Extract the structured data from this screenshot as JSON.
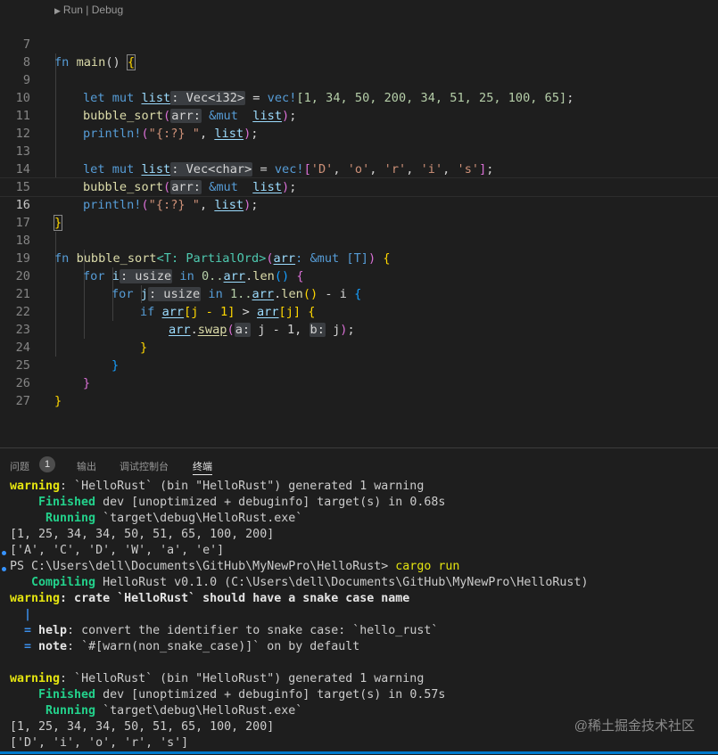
{
  "editor": {
    "codelens": {
      "run": "Run",
      "sep": "|",
      "debug": "Debug"
    },
    "lines": [
      {
        "n": "7"
      },
      {
        "n": "8"
      },
      {
        "n": "9"
      },
      {
        "n": "10"
      },
      {
        "n": "11"
      },
      {
        "n": "12"
      },
      {
        "n": "13"
      },
      {
        "n": "14"
      },
      {
        "n": "15"
      },
      {
        "n": "16"
      },
      {
        "n": "17"
      },
      {
        "n": "18"
      },
      {
        "n": "19"
      },
      {
        "n": "20"
      },
      {
        "n": "21"
      },
      {
        "n": "22"
      },
      {
        "n": "23"
      },
      {
        "n": "24"
      },
      {
        "n": "25"
      },
      {
        "n": "26"
      },
      {
        "n": "27"
      }
    ],
    "tokens": {
      "fn": "fn",
      "main": "main",
      "paren": "()",
      "brace_open": "{",
      "brace_close": "}",
      "let": "let",
      "mut": "mut",
      "list": "list",
      "hint_vec_i32": ": Vec<i32>",
      "eq": " = ",
      "vec": "vec!",
      "arr1": "[1, 34, 50, 200, 34, 51, 25, 100, 65]",
      "semi": ";",
      "bubble_sort": "bubble_sort",
      "hint_arr": "arr:",
      "amp_mut": " &mut ",
      "println": "println!",
      "fmt": "\"{:?} \"",
      "comma": ", ",
      "hint_vec_char": ": Vec<char>",
      "arr2_open": "[",
      "c1": "'D'",
      "c2": "'o'",
      "c3": "'r'",
      "c4": "'i'",
      "c5": "'s'",
      "arr2_close": "]",
      "generic": "<T: PartialOrd>",
      "sig_arr": "arr",
      "sig_rest": ": &mut [T]",
      "for": "for",
      "i": "i",
      "j": "j",
      "hint_usize": ": usize",
      "in": "in",
      "range0": "0..",
      "range1": "1..",
      "arr": "arr",
      "len": "len",
      "minus_i": " - i ",
      "if": "if",
      "idx_j1": "[j - 1]",
      "gt": " > ",
      "idx_j": "[j]",
      "swap": "swap",
      "hint_a": "a:",
      "j_minus_1": " j - 1, ",
      "hint_b": "b:",
      "j_end": " j"
    }
  },
  "panel": {
    "tabs": [
      {
        "label": "问题"
      },
      {
        "label": "输出"
      },
      {
        "label": "调试控制台"
      },
      {
        "label": "终端"
      }
    ],
    "problem_count": "1",
    "terminal": [
      {
        "a": "warning",
        "b": ": `HelloRust` (bin \"HelloRust\") generated 1 warning"
      },
      {
        "a": "    Finished",
        "b": " dev [unoptimized + debuginfo] target(s) in 0.68s"
      },
      {
        "a": "     Running",
        "b": " `target\\debug\\HelloRust.exe`"
      },
      {
        "b": "[1, 25, 34, 34, 50, 51, 65, 100, 200]"
      },
      {
        "b": "['A', 'C', 'D', 'W', 'a', 'e']"
      },
      {
        "b": "PS C:\\Users\\dell\\Documents\\GitHub\\MyNewPro\\HelloRust> ",
        "cmd": "cargo run"
      },
      {
        "a": "   Compiling",
        "b": " HelloRust v0.1.0 (C:\\Users\\dell\\Documents\\GitHub\\MyNewPro\\HelloRust)"
      },
      {
        "a": "warning",
        "c": ": crate `HelloRust` should have a snake case name"
      },
      {
        "p": "  |"
      },
      {
        "p": "  = ",
        "h": "help",
        "b": ": convert the identifier to snake case: `hello_rust`"
      },
      {
        "p": "  = ",
        "h": "note",
        "b": ": `#[warn(non_snake_case)]` on by default"
      },
      {
        "b": ""
      },
      {
        "a": "warning",
        "b": ": `HelloRust` (bin \"HelloRust\") generated 1 warning"
      },
      {
        "a": "    Finished",
        "b": " dev [unoptimized + debuginfo] target(s) in 0.57s"
      },
      {
        "a": "     Running",
        "b": " `target\\debug\\HelloRust.exe`"
      },
      {
        "b": "[1, 25, 34, 34, 50, 51, 65, 100, 200]"
      },
      {
        "b": "['D', 'i', 'o', 'r', 's']"
      }
    ],
    "watermark": "@稀土掘金技术社区"
  }
}
